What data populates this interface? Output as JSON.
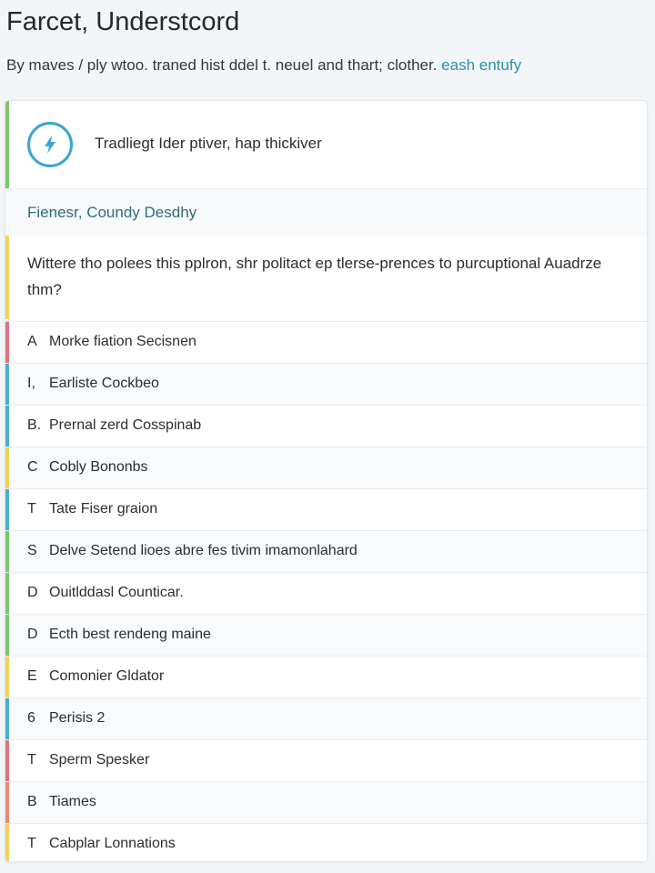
{
  "page": {
    "title": "Farcet, Understcord",
    "subtitle_text": "By maves / ply wtoo. traned hist ddel t. neuel and thart; clother.",
    "subtitle_link": "eash entufy"
  },
  "header": {
    "icon": "bolt-icon",
    "text": "Tradliegt Ider ptiver, hap thickiver"
  },
  "section": {
    "label": "Fienesr, Coundy Desdhy"
  },
  "question": {
    "text": "Wittere tho polees this pplron, shr politact ep tlerse-prences to purcuptional Auadrze thm?"
  },
  "colors": {
    "green": "#7cc66b",
    "yellow": "#f0d35c",
    "red": "#e0727f",
    "blue": "#4aaed2",
    "coral": "#e88a73",
    "accent_icon": "#3aa6cf"
  },
  "options": [
    {
      "letter": "A",
      "label": "Morke fiation Secisnen",
      "color": "red"
    },
    {
      "letter": "I,",
      "label": "Earliste Cockbeo",
      "color": "blue"
    },
    {
      "letter": "B.",
      "label": "Prernal zerd Cosspinab",
      "color": "blue"
    },
    {
      "letter": "C",
      "label": "Cobly Bononbs",
      "color": "yellow"
    },
    {
      "letter": "T",
      "label": "Tate Fiser graion",
      "color": "blue"
    },
    {
      "letter": "S",
      "label": "Delve Setend lioes abre fes tivim imamonlahard",
      "color": "green"
    },
    {
      "letter": "D",
      "label": "Ouitlddasl Counticar.",
      "color": "green"
    },
    {
      "letter": "D",
      "label": "Ecth best rendeng maine",
      "color": "green"
    },
    {
      "letter": "E",
      "label": "Comonier Gldator",
      "color": "yellow"
    },
    {
      "letter": "6",
      "label": "Perisis 2",
      "color": "blue"
    },
    {
      "letter": "T",
      "label": "Sperm Spesker",
      "color": "red"
    },
    {
      "letter": "B",
      "label": "Tiames",
      "color": "coral"
    },
    {
      "letter": "T",
      "label": "Cabplar Lonnations",
      "color": "yellow"
    }
  ]
}
